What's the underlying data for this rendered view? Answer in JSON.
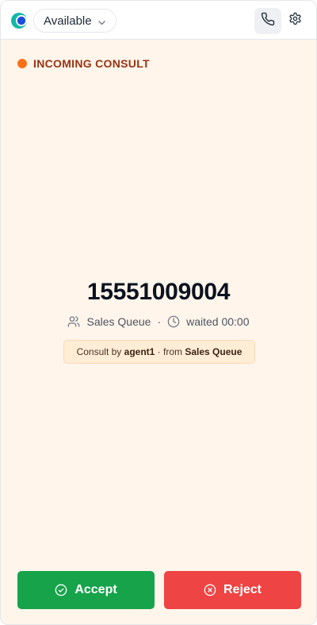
{
  "header": {
    "status_value": "Available",
    "icons": [
      "logo-icon",
      "chevron-down-icon",
      "phone-icon",
      "gear-icon"
    ]
  },
  "call": {
    "state_label": "INCOMING CONSULT",
    "state_dot_color": "#f97316",
    "number": "15551009004",
    "queue": "Sales Queue",
    "separator": "·",
    "waited": "waited 00:00",
    "consult": {
      "prefix": "Consult by",
      "agent": "agent1",
      "middle": "· from",
      "queue": "Sales Queue"
    }
  },
  "actions": {
    "accept_label": "Accept",
    "accept_color": "#16a34a",
    "reject_label": "Reject",
    "reject_color": "#ef4444"
  }
}
